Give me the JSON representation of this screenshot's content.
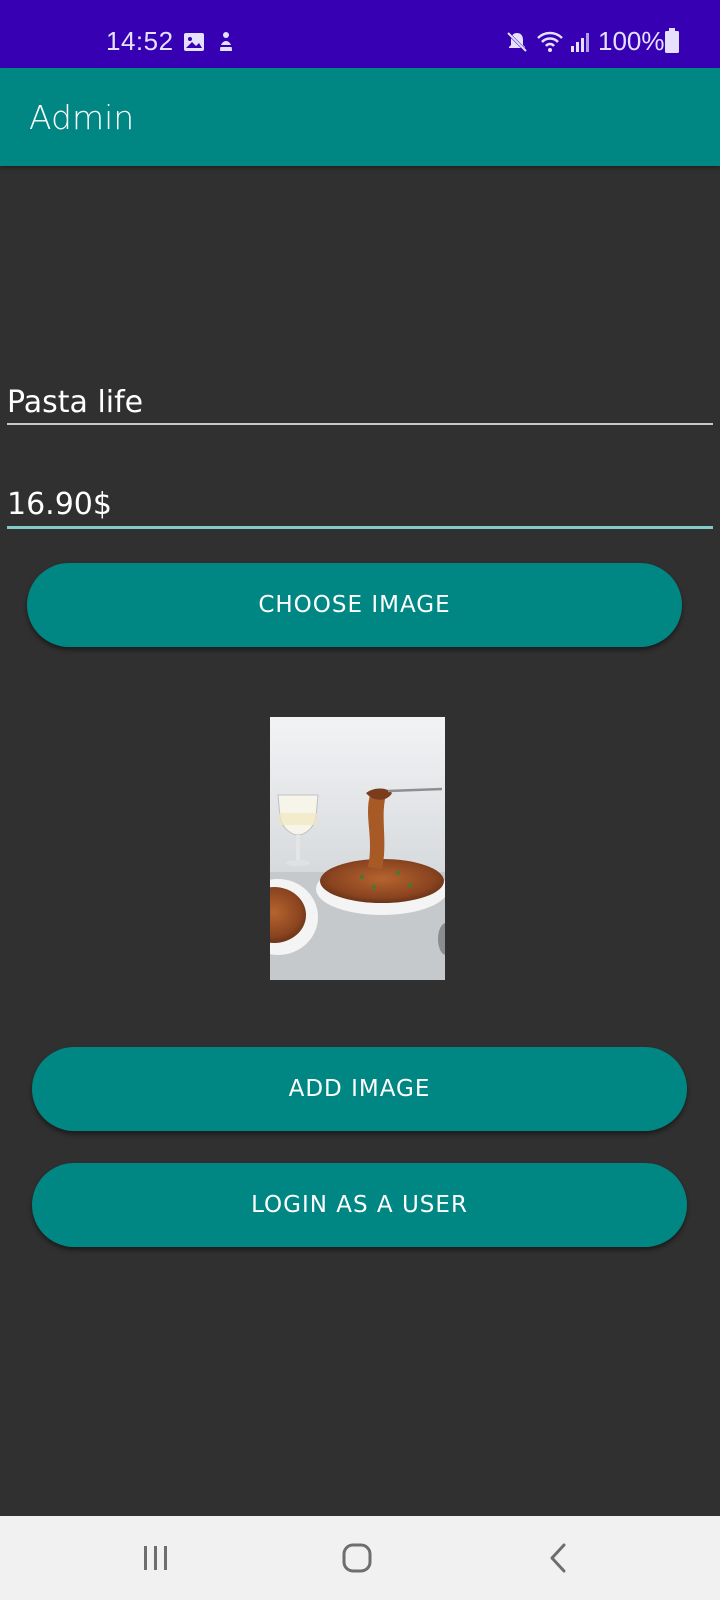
{
  "status_bar": {
    "time": "14:52",
    "battery": "100%",
    "icons": [
      "gallery-icon",
      "accessibility-icon",
      "mute-icon",
      "wifi-icon",
      "signal-icon",
      "battery-icon"
    ]
  },
  "app_bar": {
    "title": "Admin"
  },
  "form": {
    "name_value": "Pasta life",
    "price_value": "16.90$",
    "choose_image_label": "CHOOSE IMAGE",
    "add_image_label": "ADD IMAGE",
    "login_user_label": "LOGIN AS A USER"
  },
  "colors": {
    "status_bar": "#3700b3",
    "primary": "#008784",
    "background": "#303030",
    "focused_underline": "#80cbc4"
  },
  "nav_bar": {
    "icons": [
      "recents-icon",
      "home-icon",
      "back-icon"
    ]
  }
}
